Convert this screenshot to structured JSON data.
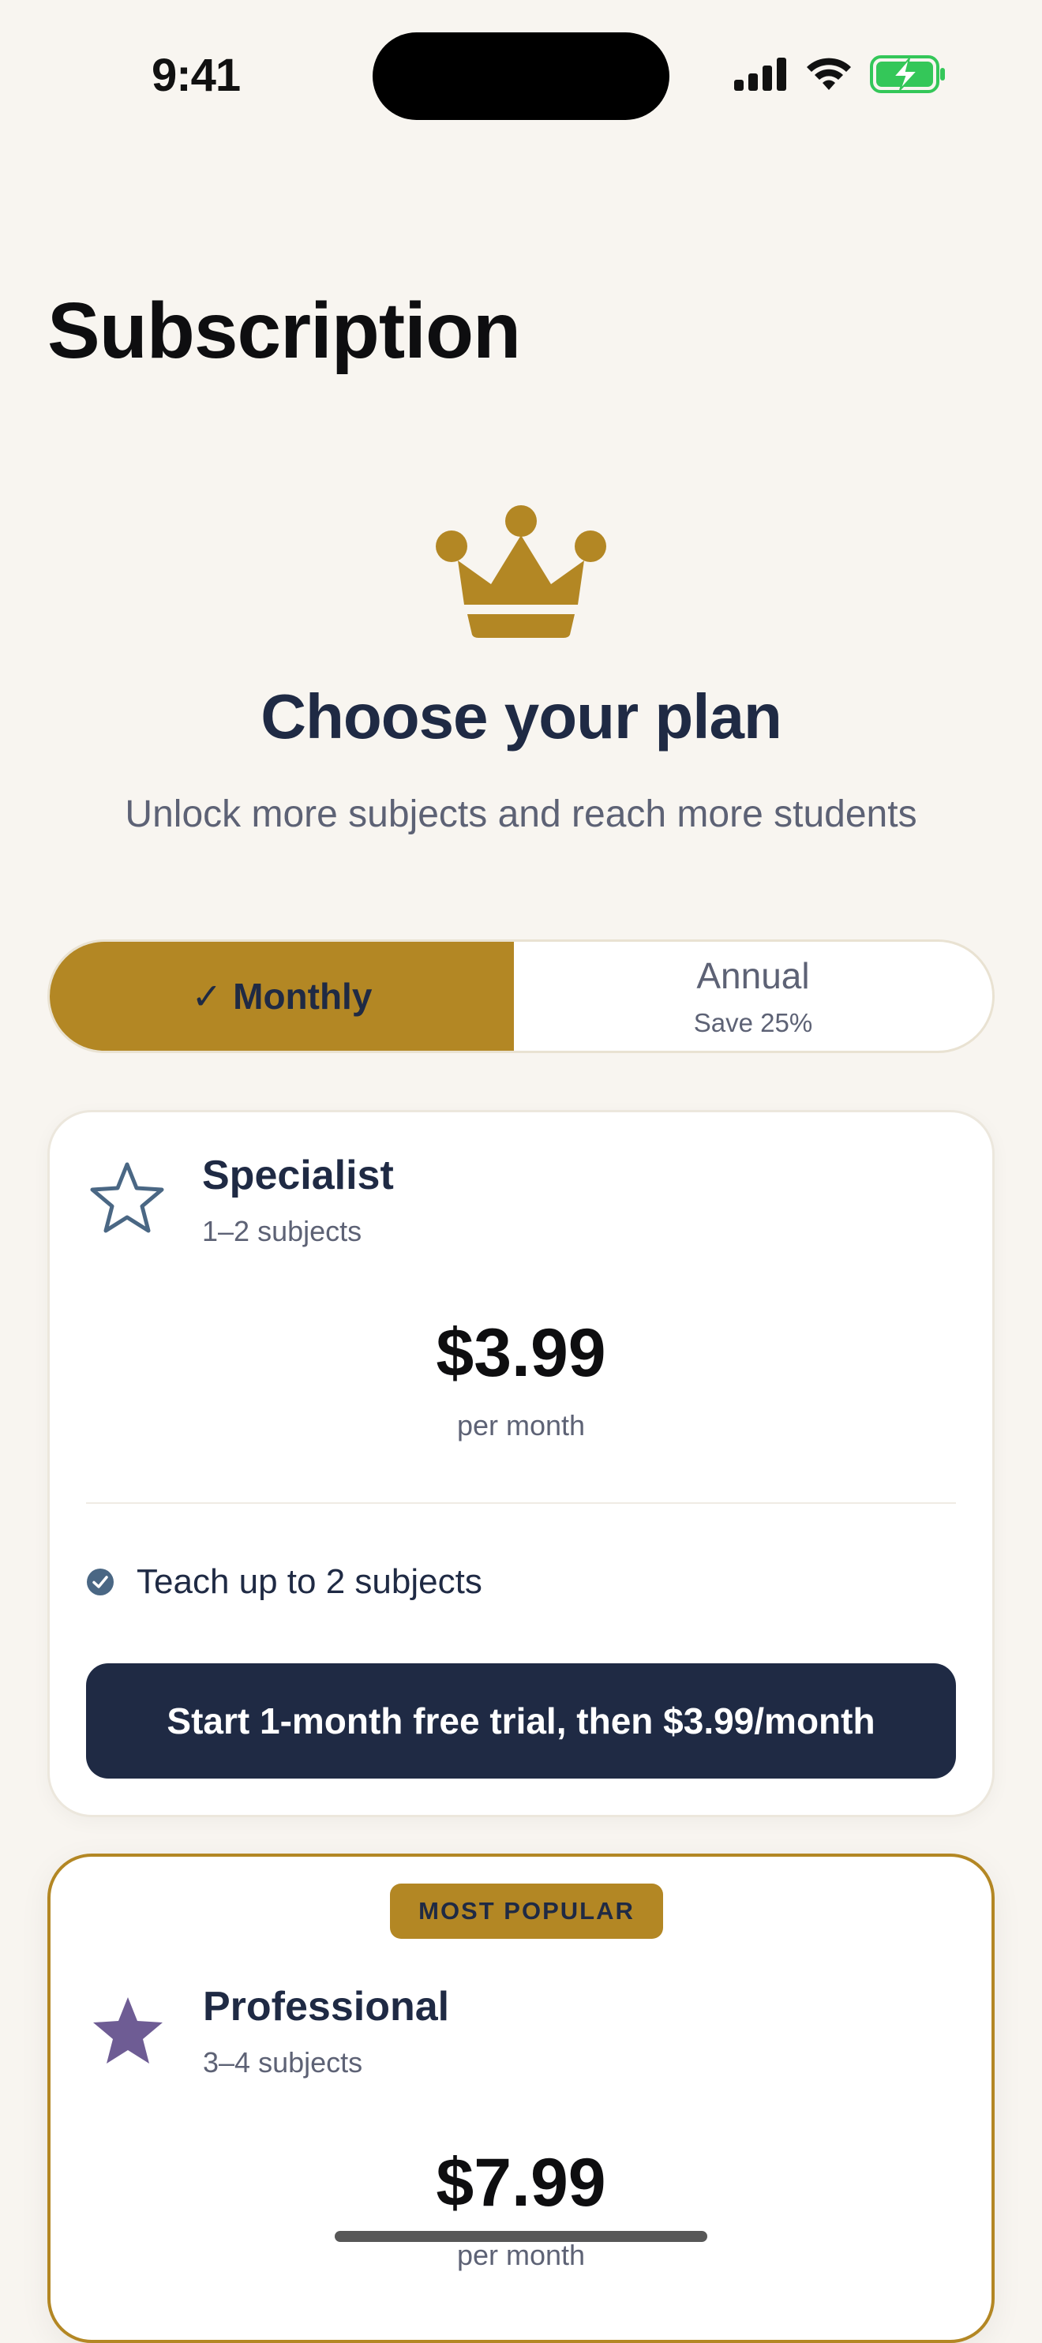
{
  "status_bar": {
    "time": "9:41"
  },
  "page": {
    "title": "Subscription"
  },
  "hero": {
    "icon": "crown-icon",
    "headline": "Choose your plan",
    "subhead": "Unlock more subjects and reach more students"
  },
  "billing_toggle": {
    "monthly": {
      "check": "✓",
      "label": "Monthly",
      "selected": true
    },
    "annual": {
      "label": "Annual",
      "note": "Save 25%",
      "selected": false
    }
  },
  "plans": [
    {
      "name": "Specialist",
      "subjects": "1–2 subjects",
      "icon": "star-outline-icon",
      "price": "$3.99",
      "period": "per month",
      "features": [
        "Teach up to 2 subjects"
      ],
      "cta": "Start 1-month free trial, then $3.99/month"
    },
    {
      "badge": "MOST POPULAR",
      "name": "Professional",
      "subjects": "3–4 subjects",
      "icon": "star-filled-icon",
      "price": "$7.99",
      "period": "per month"
    }
  ],
  "colors": {
    "background": "#F8F5F0",
    "accent_gold": "#B38724",
    "navy": "#1F2A44",
    "muted_text": "#5D6275",
    "specialist_star": "#4A6784",
    "professional_star": "#6E5C94",
    "battery_green": "#34C759"
  }
}
